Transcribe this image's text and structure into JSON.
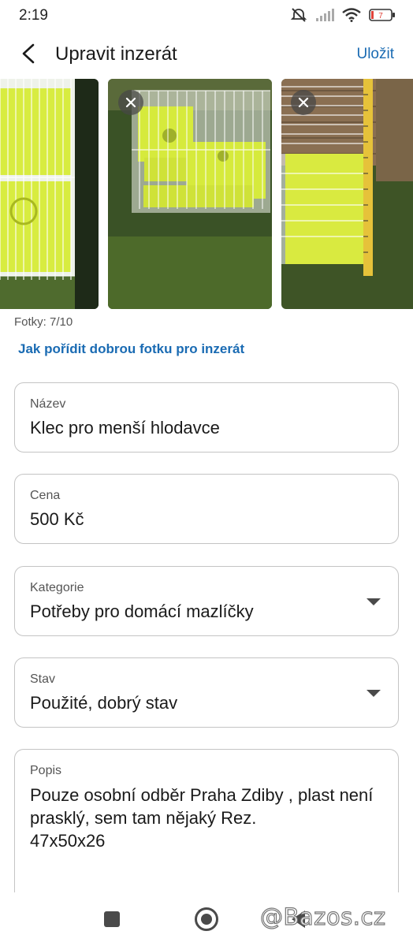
{
  "status": {
    "time": "2:19",
    "battery": "7",
    "icons": [
      "mute-icon",
      "signal-icon",
      "wifi-icon",
      "battery-icon"
    ]
  },
  "app_bar": {
    "title": "Upravit inzerát",
    "save_label": "Uložit",
    "accent_color": "#1a6bb3"
  },
  "photos": {
    "count_text": "Fotky: 7/10",
    "help_link": "Jak pořídit dobrou fotku pro inzerát",
    "items": [
      {
        "subject": "white wire cage with yellow plastic base on grass"
      },
      {
        "subject": "white wire cage with yellow plastic house on grass"
      },
      {
        "subject": "yellow cage base next to measuring tape"
      }
    ]
  },
  "form": {
    "nazev": {
      "label": "Název",
      "value": "Klec pro menší hlodavce"
    },
    "cena": {
      "label": "Cena",
      "value": "500 Kč"
    },
    "kategorie": {
      "label": "Kategorie",
      "value": "Potřeby pro domácí mazlíčky"
    },
    "stav": {
      "label": "Stav",
      "value": "Použité, dobrý stav"
    },
    "popis": {
      "label": "Popis",
      "value": "Pouze osobní odběr Praha Zdiby , plast není prasklý, sem tam nějaký Rez.\n47x50x26"
    }
  },
  "watermark": "@Bazos.cz"
}
